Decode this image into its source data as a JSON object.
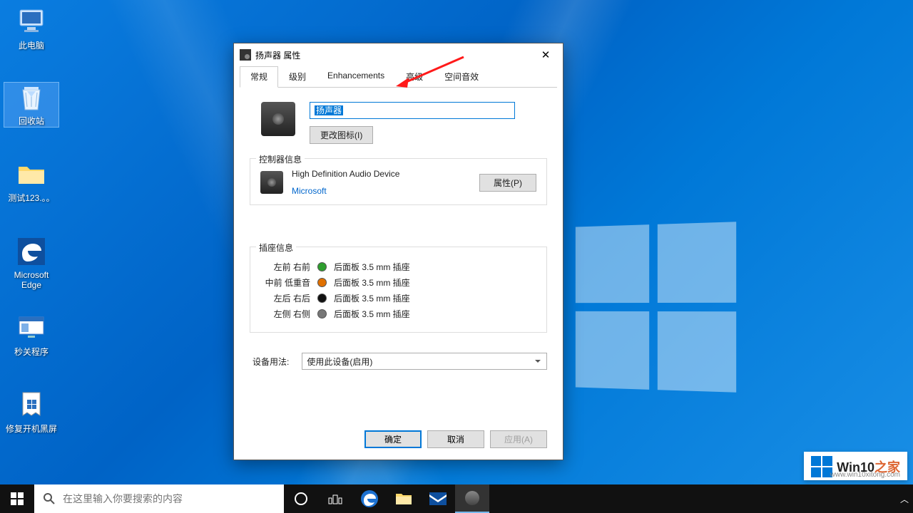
{
  "desktop": {
    "icons": [
      {
        "name": "此电脑"
      },
      {
        "name": "回收站"
      },
      {
        "name": "测试123.。。"
      },
      {
        "name": "Microsoft Edge"
      },
      {
        "name": "秒关程序"
      },
      {
        "name": "修复开机黑屏"
      }
    ]
  },
  "taskbar": {
    "search_placeholder": "在这里输入你要搜索的内容"
  },
  "dialog": {
    "title": "扬声器 属性",
    "tabs": [
      "常规",
      "级别",
      "Enhancements",
      "高级",
      "空间音效"
    ],
    "active_tab": 0,
    "device_name": "扬声器",
    "change_icon_btn": "更改图标(I)",
    "controller_group": "控制器信息",
    "controller_name": "High Definition Audio Device",
    "controller_vendor": "Microsoft",
    "properties_btn": "属性(P)",
    "jack_group": "插座信息",
    "jacks": [
      {
        "label": "左前 右前",
        "color": "#2e9e2e",
        "desc": "后面板 3.5 mm 插座"
      },
      {
        "label": "中前 低重音",
        "color": "#e07000",
        "desc": "后面板 3.5 mm 插座"
      },
      {
        "label": "左后 右后",
        "color": "#111",
        "desc": "后面板 3.5 mm 插座"
      },
      {
        "label": "左侧 右侧",
        "color": "#777",
        "desc": "后面板 3.5 mm 插座"
      }
    ],
    "usage_label": "设备用法:",
    "usage_value": "使用此设备(启用)",
    "ok": "确定",
    "cancel": "取消",
    "apply": "应用(A)"
  },
  "watermark": {
    "brand": "Win10",
    "suffix": "之家",
    "url": "www.win10xitong.com"
  }
}
